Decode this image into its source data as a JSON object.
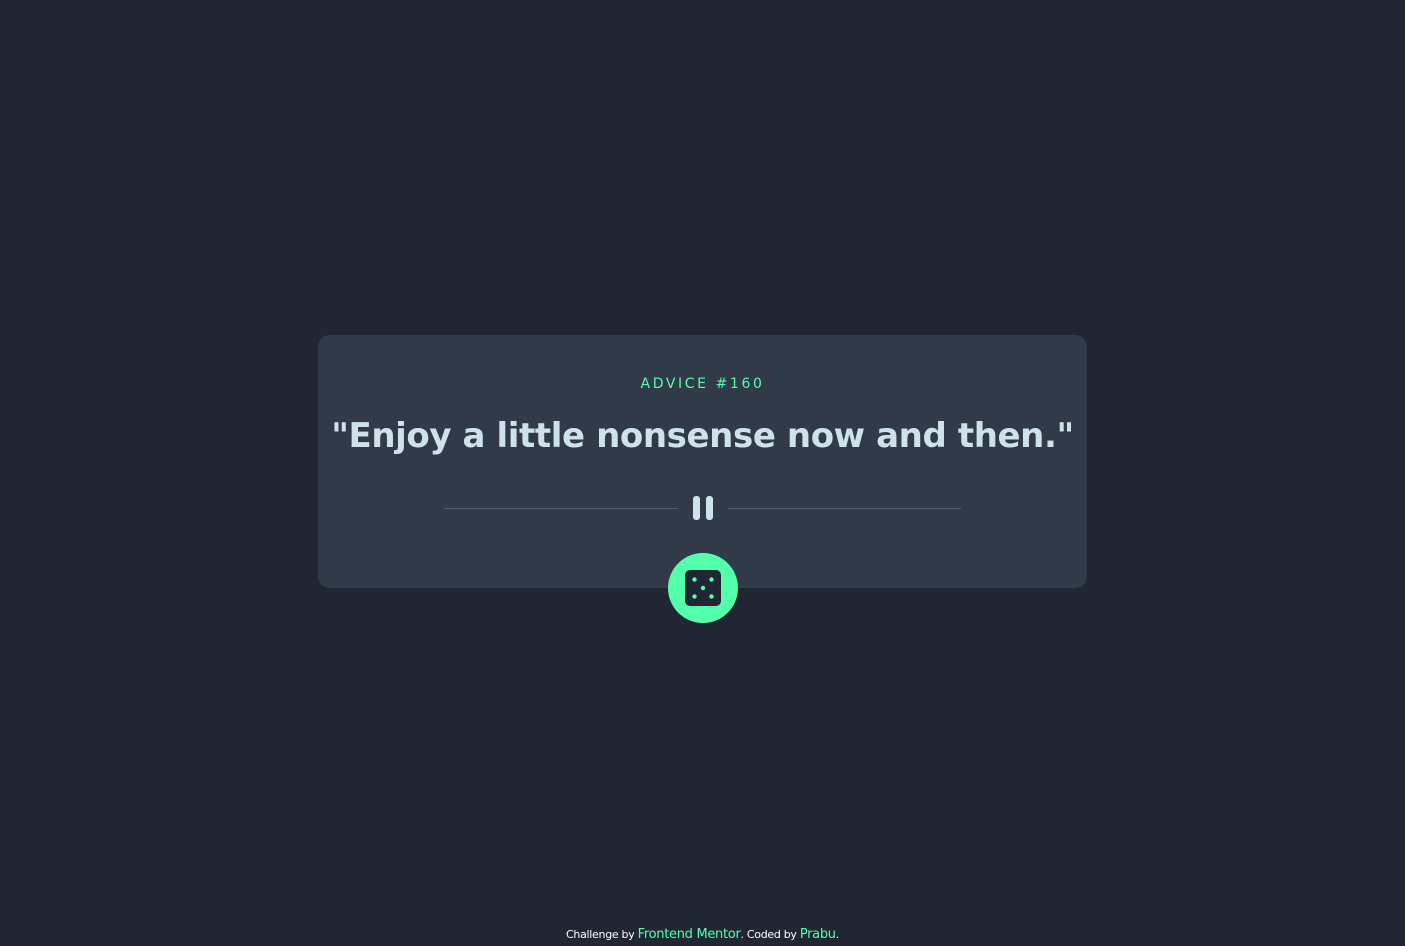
{
  "advice": {
    "id_label": "ADVICE #160",
    "quote": "\"Enjoy a little nonsense now and then.\""
  },
  "icons": {
    "divider": "pause-icon",
    "dice": "dice-icon"
  },
  "attribution": {
    "prefix": "Challenge by ",
    "challenge_link": "Frontend Mentor",
    "middle": ". Coded by ",
    "author_link": "Prabu",
    "suffix": "."
  },
  "colors": {
    "background": "#202733",
    "card": "#313a48",
    "accent": "#53ffaa",
    "quote_text": "#cee3e9",
    "divider": "#4f5d74"
  }
}
